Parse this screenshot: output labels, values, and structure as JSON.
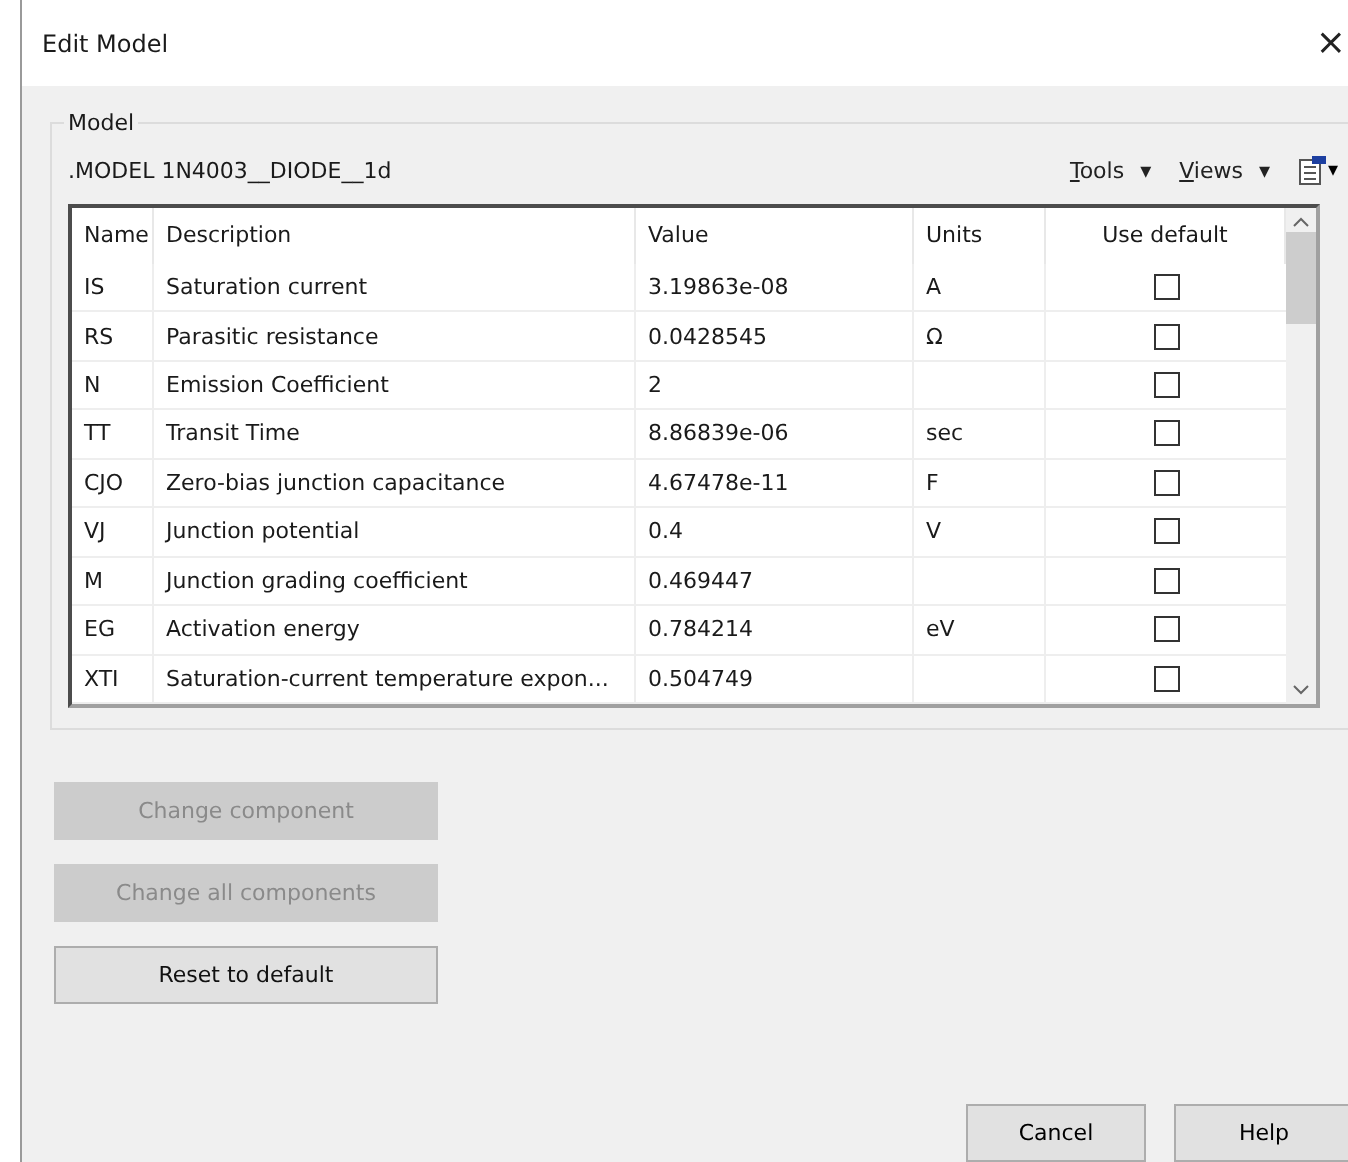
{
  "window": {
    "title": "Edit Model",
    "close": "×"
  },
  "group": {
    "title": "Model",
    "model_name": ".MODEL 1N4003__DIODE__1d",
    "menus": [
      {
        "label": "Tools",
        "caret": "▾"
      },
      {
        "label": "Views",
        "caret": "▾"
      }
    ],
    "tool_caret": "▾"
  },
  "table": {
    "columns": [
      "Name",
      "Description",
      "Value",
      "Units",
      "Use default"
    ],
    "rows": [
      {
        "name": "IS",
        "description": "Saturation current",
        "value": "3.19863e-08",
        "units": "A",
        "use_default": false
      },
      {
        "name": "RS",
        "description": "Parasitic resistance",
        "value": "0.0428545",
        "units": "Ω",
        "use_default": false
      },
      {
        "name": "N",
        "description": "Emission Coefficient",
        "value": "2",
        "units": "",
        "use_default": false
      },
      {
        "name": "TT",
        "description": "Transit Time",
        "value": "8.86839e-06",
        "units": "sec",
        "use_default": false
      },
      {
        "name": "CJO",
        "description": "Zero-bias junction capacitance",
        "value": "4.67478e-11",
        "units": "F",
        "use_default": false
      },
      {
        "name": "VJ",
        "description": "Junction potential",
        "value": "0.4",
        "units": "V",
        "use_default": false
      },
      {
        "name": "M",
        "description": "Junction grading coefficient",
        "value": "0.469447",
        "units": "",
        "use_default": false
      },
      {
        "name": "EG",
        "description": "Activation energy",
        "value": "0.784214",
        "units": "eV",
        "use_default": false
      },
      {
        "name": "XTI",
        "description": "Saturation-current temperature expon...",
        "value": "0.504749",
        "units": "",
        "use_default": false
      }
    ]
  },
  "side_buttons": [
    {
      "label": "Change component",
      "disabled": true
    },
    {
      "label": "Change all components",
      "disabled": true
    },
    {
      "label": "Reset to default",
      "disabled": false
    }
  ],
  "footer_buttons": [
    {
      "label": "Cancel"
    },
    {
      "label": "Help"
    }
  ]
}
